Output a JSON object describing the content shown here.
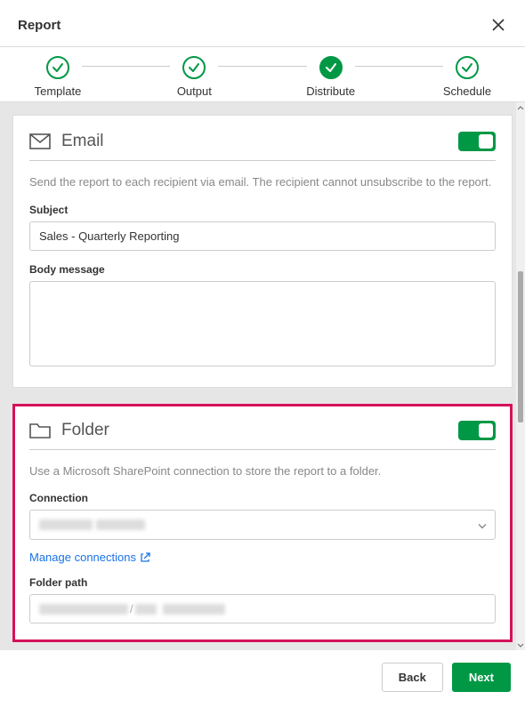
{
  "header": {
    "title": "Report"
  },
  "stepper": {
    "steps": [
      {
        "label": "Template",
        "filled": false
      },
      {
        "label": "Output",
        "filled": false
      },
      {
        "label": "Distribute",
        "filled": true
      },
      {
        "label": "Schedule",
        "filled": false
      }
    ]
  },
  "email": {
    "title": "Email",
    "helper": "Send the report to each recipient via email. The recipient cannot unsubscribe to the report.",
    "subject_label": "Subject",
    "subject_value": "Sales - Quarterly Reporting",
    "body_label": "Body message",
    "body_value": "",
    "toggle_on": true
  },
  "folder": {
    "title": "Folder",
    "helper": "Use a Microsoft SharePoint connection to store the report to a folder.",
    "connection_label": "Connection",
    "connection_value": "",
    "manage_link": "Manage connections",
    "path_label": "Folder path",
    "path_value": "",
    "toggle_on": true
  },
  "footer": {
    "back": "Back",
    "next": "Next"
  },
  "colors": {
    "accent": "#009845",
    "highlight": "#d6115a",
    "link": "#1a73e8"
  }
}
